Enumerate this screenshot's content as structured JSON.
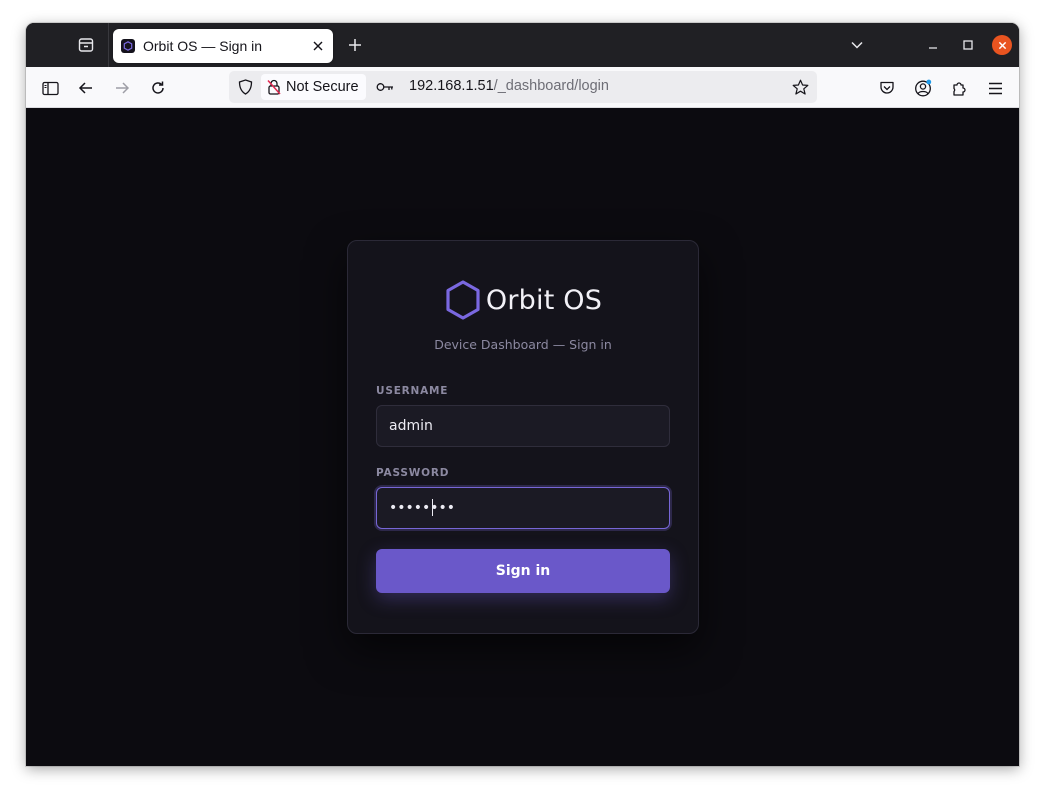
{
  "browser": {
    "tab": {
      "title": "Orbit OS — Sign in"
    },
    "url": {
      "security_label": "Not Secure",
      "host": "192.168.1.51",
      "path": "/_dashboard/login"
    }
  },
  "page": {
    "brand": "Orbit OS",
    "subtitle": "Device Dashboard — Sign in",
    "username": {
      "label": "USERNAME",
      "value": "admin"
    },
    "password": {
      "label": "PASSWORD",
      "masked_value": "••••••••"
    },
    "signin_label": "Sign in"
  },
  "colors": {
    "accent": "#6a58c9",
    "background": "#0c0b10",
    "card": "#14131b"
  }
}
